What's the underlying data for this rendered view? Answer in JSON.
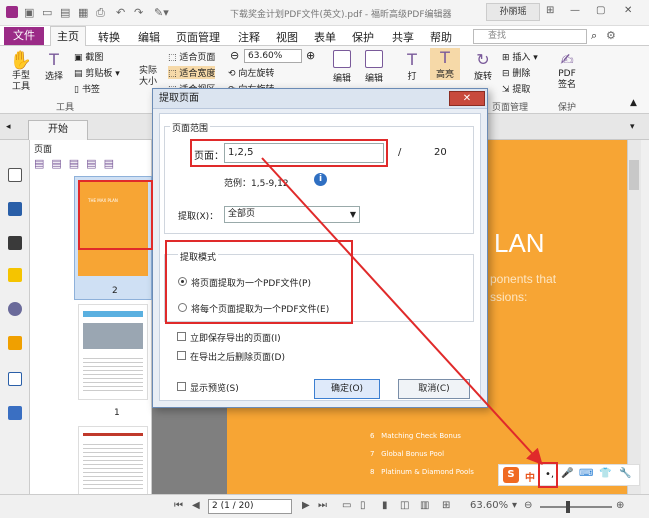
{
  "window": {
    "title": "下载奖金计划PDF文件(英文).pdf - 福昕高级PDF编辑器",
    "user": "孙丽瑶",
    "controls": [
      "⊞",
      "—",
      "▢",
      "✕"
    ]
  },
  "quick_access": [
    "▣",
    "▭",
    "▤",
    "▦",
    "⎙",
    "↶",
    "↷",
    "✎▾"
  ],
  "menu": {
    "file": "文件",
    "home": "主页",
    "items": [
      "转换",
      "编辑",
      "页面管理",
      "注释",
      "视图",
      "表单",
      "保护",
      "共享",
      "帮助"
    ],
    "search_placeholder": "查找"
  },
  "ribbon": {
    "hand_tool": "手型工具",
    "select": "选择",
    "screenshot": "截图",
    "clipboard": "剪贴板",
    "bookmark": "书签",
    "actual_size": "实际大小",
    "fit_page": "适合页面",
    "fit_width": "适合宽度",
    "fit_visible": "适合视区",
    "zoom_value": "63.60%",
    "rotate_left": "向左旋转",
    "rotate_right": "向右旋转",
    "edit_text": "编辑",
    "edit_object": "编辑",
    "typewriter": "打",
    "highlight": "高亮",
    "rotate": "旋转",
    "insert": "插入",
    "delete": "删除",
    "extract": "提取",
    "pdf_sign": "PDF签名",
    "group_tools": "工具",
    "group_pages": "页面管理",
    "group_protect": "保护"
  },
  "doc_tab": "开始",
  "pages_panel": {
    "title": "页面",
    "page_labels": [
      "2",
      "1"
    ],
    "thumb_title": "THE MAX PLAN"
  },
  "document": {
    "heading": "LAN",
    "subheading_1": "ponents that",
    "subheading_2": "ssions:",
    "list": [
      {
        "num": "6",
        "text": "Matching Check Bonus"
      },
      {
        "num": "7",
        "text": "Global Bonus Pool"
      },
      {
        "num": "8",
        "text": "Platinum & Diamond Pools"
      }
    ]
  },
  "dialog": {
    "title": "提取页面",
    "close": "✕",
    "range_group": "页面范围",
    "pages_label": "页面：",
    "pages_value": "1,2,5",
    "slash": "/",
    "total": "20",
    "example": "范例：1,5-9,12",
    "extract_label": "提取(X)：",
    "extract_value": "全部页",
    "mode_group": "提取模式",
    "mode_single": "将页面提取为一个PDF文件(P)",
    "mode_each": "将每个页面提取为一个PDF文件(E)",
    "save_now": "立即保存导出的页面(I)",
    "delete_after": "在导出之后删除页面(D)",
    "preview": "显示预览(S)",
    "ok": "确定(O)",
    "cancel": "取消(C)"
  },
  "ime": {
    "logo": "S",
    "lang": "中",
    "items": [
      "•,",
      "🎤",
      "⌨",
      "👕",
      "🔧"
    ]
  },
  "status": {
    "page_field": "2 (1 / 20)",
    "zoom": "63.60%"
  },
  "colors": {
    "brand_purple": "#9b2b87",
    "page_orange": "#f7a534",
    "annotation_red": "#e02a2a"
  }
}
